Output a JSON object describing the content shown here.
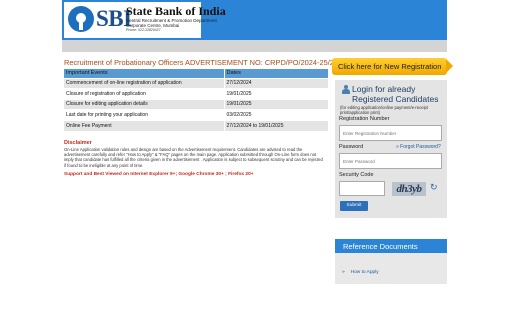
{
  "header": {
    "logo_text": "SBI",
    "bank_name": "State Bank of India",
    "department": "Central Recruitment & Promotion Department",
    "corporate": "Corporate Centre, Mumbai",
    "pin": "Phone: 022-22820427",
    "brand_color": "#2c84d6"
  },
  "recruitment_title": "Recruitment of Probationary Officers ADVERTISEMENT NO: CRPD/PO/2024-25/22",
  "events": {
    "columns": [
      "Important Events",
      "Dates"
    ],
    "rows": [
      [
        "Commencement of on-line registration of application",
        "27/12/2024"
      ],
      [
        "Closure of registration of application",
        "19/01/2025"
      ],
      [
        "Closure for editing application details",
        "19/01/2025"
      ],
      [
        "Last date for printing your application",
        "03/02/2025"
      ],
      [
        "Online Fee Payment",
        "27/12/2024 to 19/01/2025"
      ]
    ]
  },
  "disclaimer": {
    "heading": "Disclaimer",
    "text": "On-Line Application validation rules and design are based on the Advertisement requirement. Candidates are advised to read the advertisement carefully and refer \"How to Apply\" & \"FAQ\" pages on the main page. Application submitted through On-Line form does not imply that candidate has fulfilled all the criteria given in the advertisement . Application is subject to subsequent scrutiny and can be rejected if found to be ineligible at any point of time.",
    "browser_note": "Support and Best Viewed on Internet Explorer 9+; Google Chrome 30+ ; Firefox 20+"
  },
  "sidebar": {
    "new_registration": "Click here for New Registration",
    "login_title_line1": "Login for already",
    "login_title_line2": "Registered Candidates",
    "login_note": "(for editing application/online payment/e-receipt print/application print)",
    "registration_label": "Registration Number",
    "registration_placeholder": "Enter Registration Number",
    "password_label": "Password",
    "forgot_password": "Forgot Password?",
    "password_placeholder": "Enter Password",
    "security_code_label": "Security Code",
    "captcha_text": "dh3yb",
    "submit_label": "Submit",
    "reference_heading": "Reference Documents",
    "reference_link": "How to Apply"
  }
}
